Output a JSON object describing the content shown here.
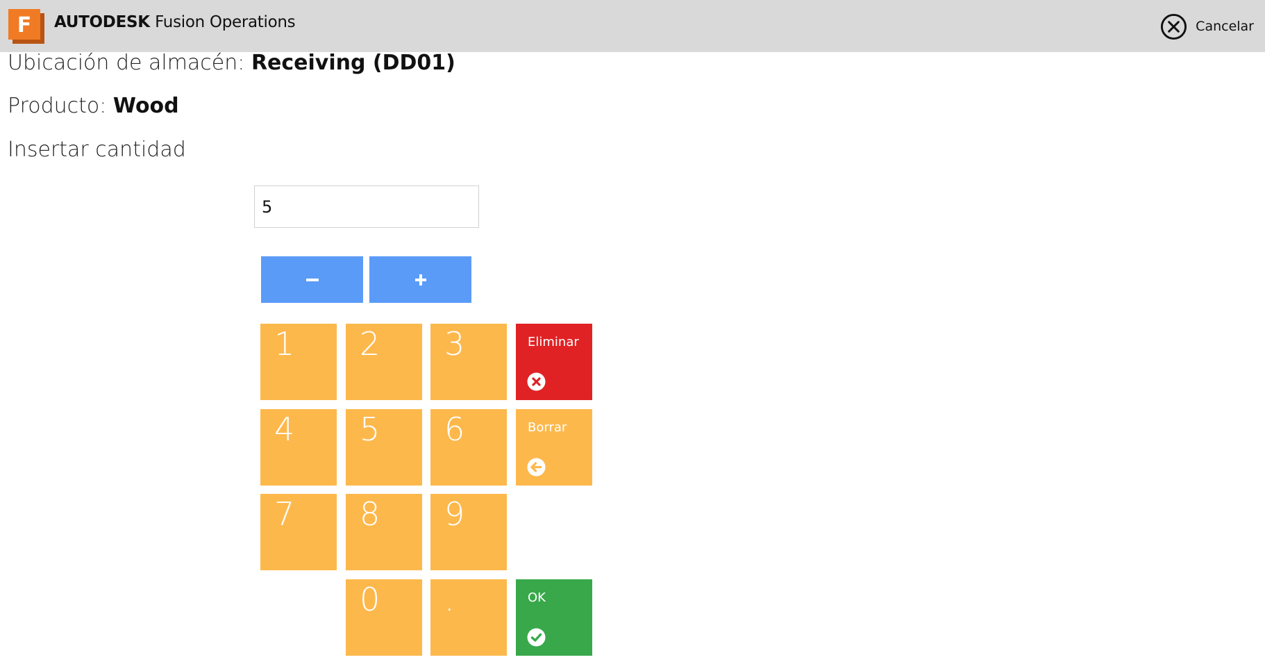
{
  "header": {
    "brand_bold": "AUTODESK",
    "brand_product": "Fusion Operations",
    "logo_letter": "F",
    "cancel_label": "Cancelar"
  },
  "info": {
    "location_label": "Ubicación de almacén:",
    "location_value": "Receiving (DD01)",
    "product_label": "Producto:",
    "product_value": "Wood",
    "instruction": "Insertar cantidad"
  },
  "quantity": {
    "value": "5"
  },
  "keypad": {
    "keys": [
      "1",
      "2",
      "3",
      "4",
      "5",
      "6",
      "7",
      "8",
      "9",
      "0",
      "."
    ],
    "delete_label": "Eliminar",
    "backspace_label": "Borrar",
    "ok_label": "OK"
  },
  "colors": {
    "header_bg": "#d9d9d9",
    "logo_orange": "#f07b24",
    "stepper_blue": "#5b9bf8",
    "key_orange": "#fdb84c",
    "delete_red": "#e02224",
    "ok_green": "#38a84a"
  },
  "icons": {
    "cancel": "circle-x-icon",
    "delete": "x-circle-icon",
    "backspace": "arrow-left-circle-icon",
    "ok": "check-circle-icon",
    "minus": "minus-icon",
    "plus": "plus-icon"
  }
}
